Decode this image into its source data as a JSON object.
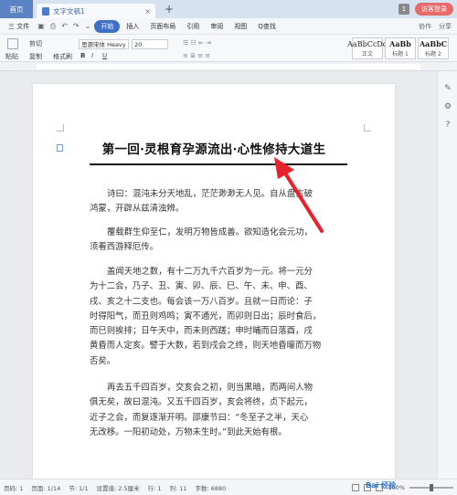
{
  "tabs": {
    "home": "首页",
    "doc": "文字文稿1",
    "add": "+",
    "count": "1"
  },
  "login": "访客登录",
  "menu": {
    "file": "三 文件",
    "items": [
      "开始",
      "插入",
      "页面布局",
      "引用",
      "审阅",
      "视图"
    ],
    "search": "Q查找",
    "right": [
      "协作",
      "分享"
    ]
  },
  "ribbon": {
    "paste": "粘贴",
    "cut": "剪切",
    "copy": "复制",
    "format_painter": "格式刷",
    "font": "思源宋体 Heavy",
    "size": "20",
    "bold": "B",
    "italic": "I",
    "underline": "U",
    "styles": [
      {
        "sample": "AaBbCcDd",
        "label": "正文"
      },
      {
        "sample": "AaBb",
        "label": "标题 1"
      },
      {
        "sample": "AaBbC",
        "label": "标题 2"
      }
    ]
  },
  "document": {
    "title": "第一回·灵根育孕源流出·心性修持大道生",
    "paragraphs": [
      [
        "诗曰：混沌未分天地乱，茫茫渺渺无人见。自从盘古破",
        "鸿蒙，开辟从兹清浊辨。"
      ],
      [
        "覆载群生仰至仁，发明万物皆成善。欲知造化会元功，",
        "须看西游释厄传。"
      ],
      [
        "盖闻天地之数，有十二万九千六百岁为一元。将一元分",
        "为十二会，乃子、丑、寅、卯、辰、巳、午、未、申、酉、",
        "戌、亥之十二支也。每会该一万八百岁。且就一日而论：子",
        "时得阳气，而丑则鸡鸣；寅不通光，而卯则日出；辰时食后，",
        "而巳则挨排；日午天中，而未则西蹉；申时晡而日落酉，戌",
        "黄昏而人定亥。譬于大数，若到戌会之终，则天地昏曚而万物",
        "否矣。"
      ],
      [
        "再去五千四百岁，交亥会之初，则当黑暗，而两间人物",
        "俱无矣，故曰混沌。又五千四百岁，亥会将终，贞下起元，",
        "近子之会，而复逐渐开明。邵康节曰：“冬至子之半，天心",
        "无改移。一阳初动处，万物未生时。”到此天始有根。"
      ]
    ]
  },
  "status": {
    "page": "页码: 1",
    "pages": "页面: 1/14",
    "section": "节: 1/1",
    "settings": "设置值: 2.5厘米",
    "row": "行: 1",
    "col": "列: 11",
    "words": "字数: 6880",
    "zoom": "100%"
  },
  "watermark": "Bai 经验",
  "colors": {
    "accent": "#3f6fc6",
    "arrow": "#e8212b",
    "login": "#e86a6a"
  }
}
